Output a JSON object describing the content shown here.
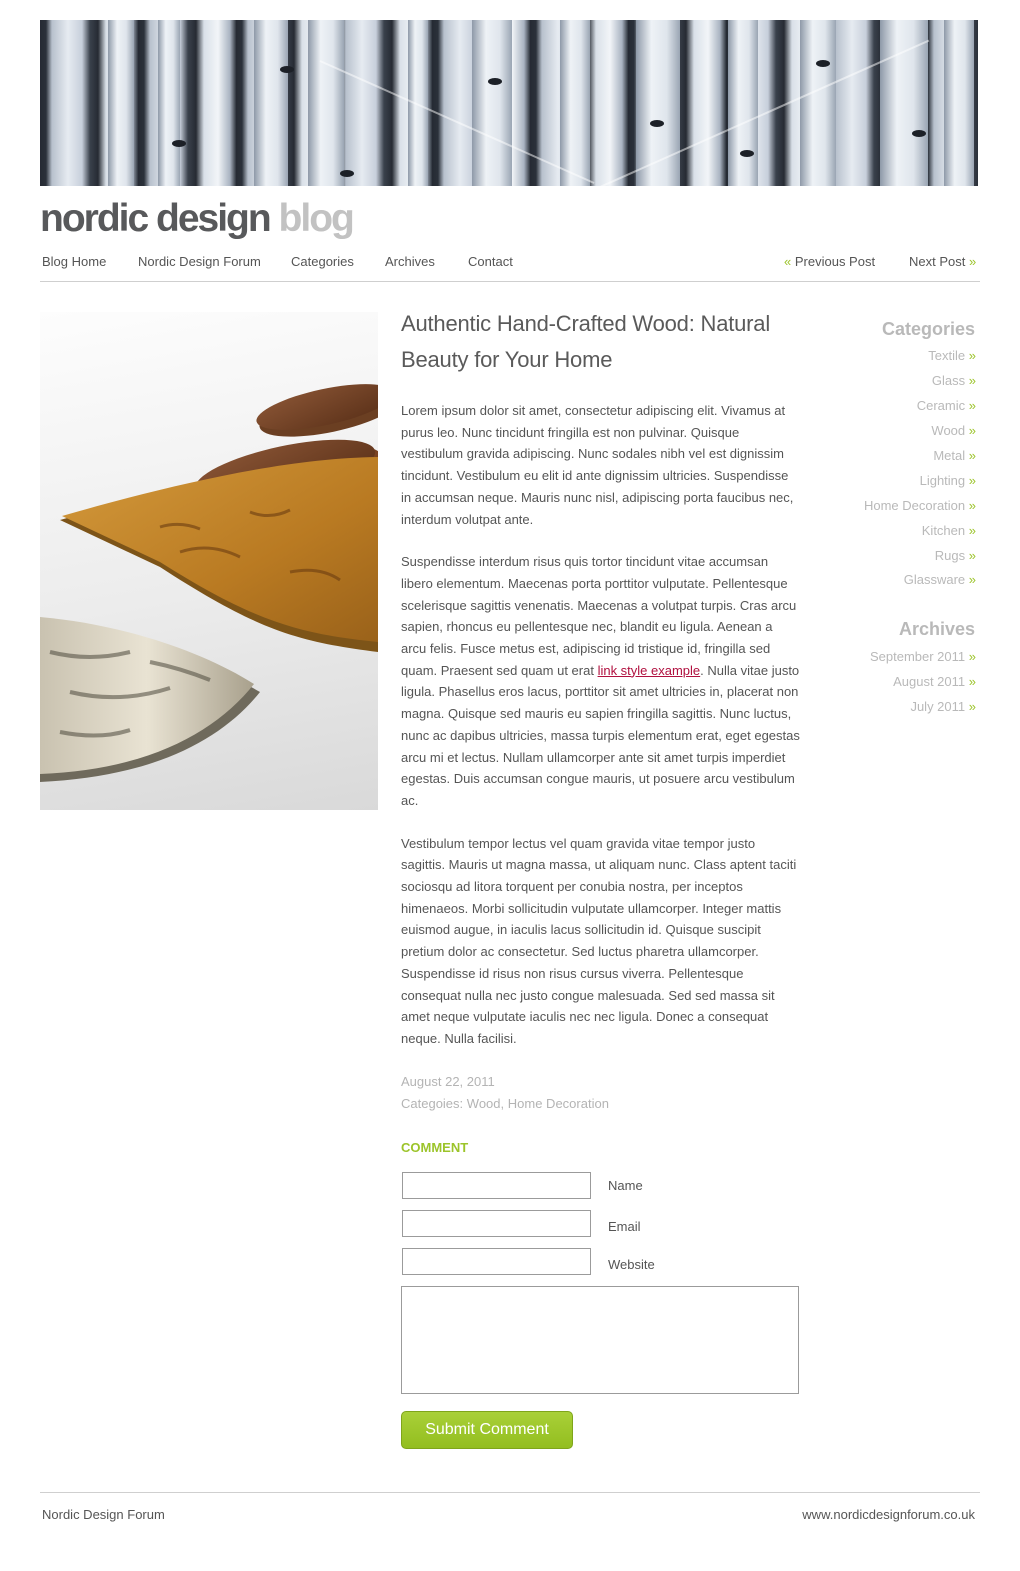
{
  "site": {
    "logo_part1": "nordic design",
    "logo_part2": "blog"
  },
  "nav": {
    "items": [
      "Blog Home",
      "Nordic Design Forum",
      "Categories",
      "Archives",
      "Contact"
    ],
    "previous_label": "Previous Post",
    "next_label": "Next Post",
    "guillemet_left": "«",
    "guillemet_right": "»"
  },
  "article": {
    "title_line1": "Authentic Hand-Crafted Wood: Natural",
    "title_line2": "Beauty for Your Home",
    "paragraph1": "Lorem ipsum dolor sit amet, consectetur adipiscing elit. Vivamus at purus leo. Nunc tincidunt fringilla est non pulvinar. Quisque vestibulum gravida adipiscing. Nunc sodales nibh vel est dignissim tincidunt. Vestibulum eu elit id ante dignissim ultricies. Suspendisse in accumsan neque. Mauris nunc nisl, adipiscing porta faucibus nec, interdum volutpat ante.",
    "paragraph2_before": "Suspendisse interdum risus quis tortor tincidunt vitae accumsan libero elementum. Maecenas porta porttitor vulputate. Pellentesque scelerisque sagittis venenatis. Maecenas a volutpat turpis. Cras arcu sapien, rhoncus eu pellentesque nec, blandit eu ligula. Aenean a arcu felis. Fusce metus est, adipiscing id tristique id, fringilla sed quam. Praesent sed quam ut erat ",
    "paragraph2_link": "link style example",
    "paragraph2_after": ". Nulla vitae justo ligula. Phasellus eros lacus, porttitor sit amet ultricies in, placerat non magna. Quisque sed mauris eu sapien fringilla sagittis. Nunc luctus, nunc ac dapibus ultricies, massa turpis elementum erat, eget egestas arcu mi et lectus. Nullam ullamcorper ante sit amet turpis imperdiet egestas. Duis accumsan congue mauris, ut posuere arcu vestibulum ac.",
    "paragraph3": "Vestibulum tempor lectus vel quam gravida vitae tempor justo sagittis. Mauris ut magna massa, ut aliquam nunc. Class aptent taciti sociosqu ad litora torquent per conubia nostra, per inceptos himenaeos. Morbi sollicitudin vulputate ullamcorper. Integer mattis euismod augue, in iaculis lacus sollicitudin id. Quisque suscipit pretium dolor ac consectetur. Sed luctus pharetra ullamcorper. Suspendisse id risus non risus cursus viverra. Pellentesque consequat nulla nec justo congue malesuada. Sed sed massa sit amet neque vulputate iaculis nec nec ligula. Donec a consequat neque. Nulla facilisi.",
    "date": "August 22, 2011",
    "categories_label": "Categoies:",
    "category1": "Wood",
    "category_separator": ",",
    "category2": "Home Decoration"
  },
  "comment": {
    "heading": "COMMENT",
    "name_label": "Name",
    "email_label": "Email",
    "website_label": "Website",
    "name_value": "",
    "email_value": "",
    "website_value": "",
    "message_value": "",
    "submit_label": "Submit Comment"
  },
  "sidebar": {
    "categories_heading": "Categories",
    "categories": [
      "Textile",
      "Glass",
      "Ceramic",
      "Wood",
      "Metal",
      "Lighting",
      "Home Decoration",
      "Kitchen",
      "Rugs",
      "Glassware"
    ],
    "archives_heading": "Archives",
    "archives": [
      "September 2011",
      "August 2011",
      "July 2011"
    ]
  },
  "footer": {
    "left": "Nordic Design Forum",
    "right": "www.nordicdesignforum.co.uk"
  },
  "colors": {
    "accent_green": "#9cc42a",
    "link_red": "#b0103f",
    "text": "#555555",
    "muted": "#b9b9b9"
  }
}
